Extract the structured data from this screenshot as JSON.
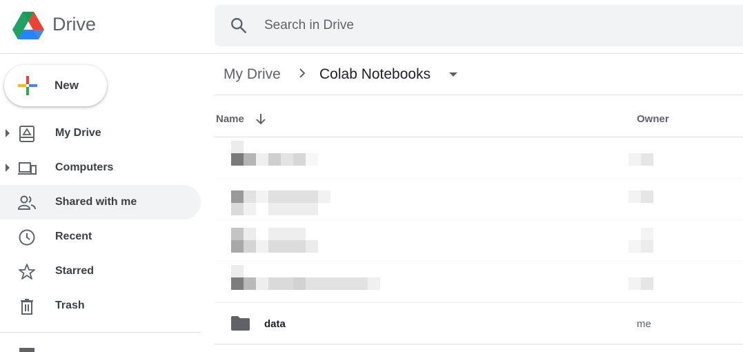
{
  "app": {
    "brand": "Drive"
  },
  "search": {
    "placeholder": "Search in Drive"
  },
  "sidebar": {
    "new_label": "New",
    "items": [
      {
        "label": "My Drive",
        "icon": "my-drive-icon"
      },
      {
        "label": "Computers",
        "icon": "computers-icon"
      },
      {
        "label": "Shared with me",
        "icon": "shared-icon"
      },
      {
        "label": "Recent",
        "icon": "clock-icon"
      },
      {
        "label": "Starred",
        "icon": "star-icon"
      },
      {
        "label": "Trash",
        "icon": "trash-icon"
      }
    ],
    "active_item": "Shared with me"
  },
  "breadcrumb": {
    "root": "My Drive",
    "current": "Colab Notebooks"
  },
  "file_list": {
    "columns": {
      "name": "Name",
      "owner": "Owner"
    },
    "sort": "descending",
    "rows": [
      {
        "name": "",
        "owner": "",
        "redacted": true
      },
      {
        "name": "",
        "owner": "",
        "redacted": true
      },
      {
        "name": "",
        "owner": "",
        "redacted": true
      },
      {
        "name": "",
        "owner": "",
        "redacted": true
      },
      {
        "name": "data",
        "owner": "me",
        "type": "folder",
        "icon": "folder-icon"
      }
    ]
  },
  "colors": {
    "accent_blue": "#4285f4",
    "accent_red": "#ea4335",
    "accent_yellow": "#fbbc04",
    "accent_green": "#34a853",
    "icon_gray": "#5f6368",
    "active_bg": "#f1f3f4"
  }
}
